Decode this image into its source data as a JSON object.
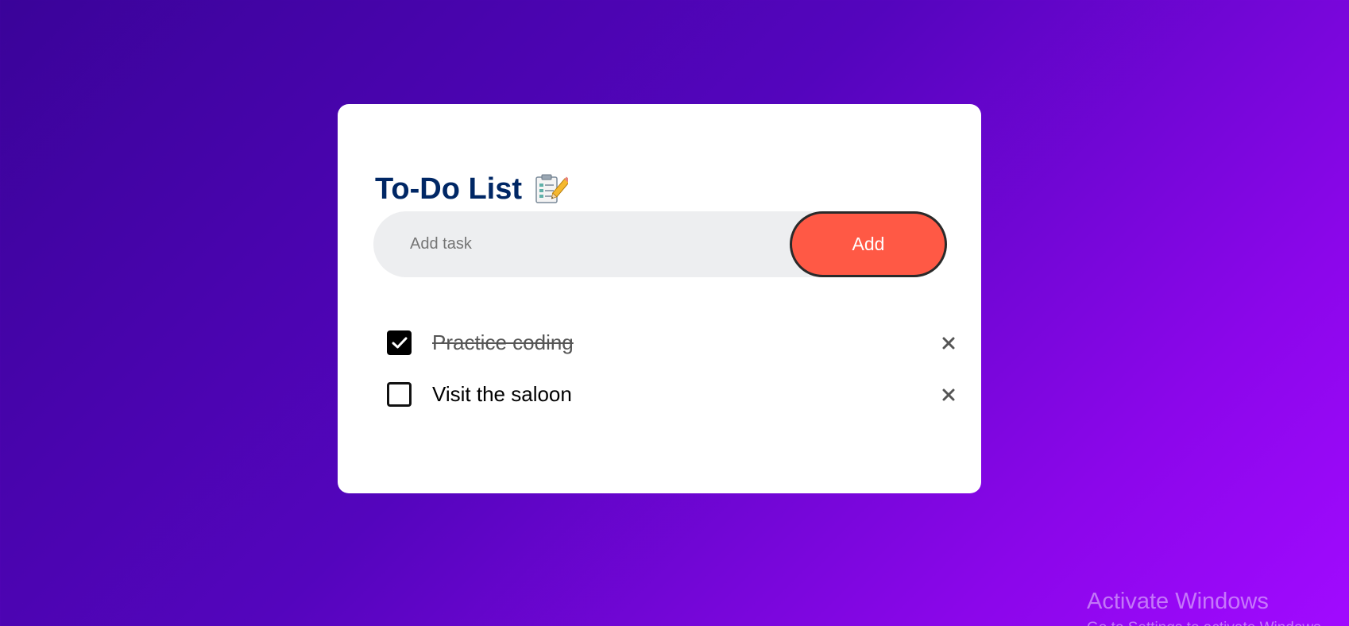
{
  "app": {
    "title": "To-Do List",
    "title_icon": "memo-checklist-icon"
  },
  "input": {
    "placeholder": "Add task",
    "value": "",
    "add_label": "Add"
  },
  "tasks": [
    {
      "text": "Practice coding",
      "completed": true
    },
    {
      "text": "Visit the saloon",
      "completed": false
    }
  ],
  "watermark": {
    "title": "Activate Windows",
    "subtitle": "Go to Settings to activate Windows."
  },
  "colors": {
    "title": "#002765",
    "add_button": "#ff5945",
    "input_bg": "#edeef0",
    "background_start": "#3a0399",
    "background_end": "#a10aff"
  }
}
